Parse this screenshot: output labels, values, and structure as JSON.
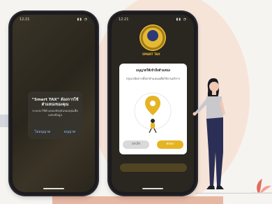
{
  "left_phone": {
    "status_time": "12:21",
    "status_icons": "▮▮ ◔",
    "dialog": {
      "title": "“Smart TAX” ต้องการใช้ตำแหน่งของคุณ",
      "body": "ระบบจะใช้ตำแหน่งปัจจุบันของคุณเพื่อแสดงข้อมูล",
      "deny": "ไม่อนุญาต",
      "allow": "อนุญาต"
    }
  },
  "right_phone": {
    "status_time": "12:21",
    "status_icons": "▮▮ ◔",
    "logo_text": "SMART TAX",
    "dialog": {
      "header": "อนุญาตให้เข้าถึงตำแหน่ง",
      "body": "กรุณาเปิดการตั้งค่าตำแหน่งเพื่อใช้งานบริการ",
      "cancel": "ยกเลิก",
      "confirm": "ตกลง"
    }
  },
  "colors": {
    "accent_gold": "#e6b423",
    "peach": "#f7e4d8",
    "phone_frame": "#1b1b1f"
  }
}
